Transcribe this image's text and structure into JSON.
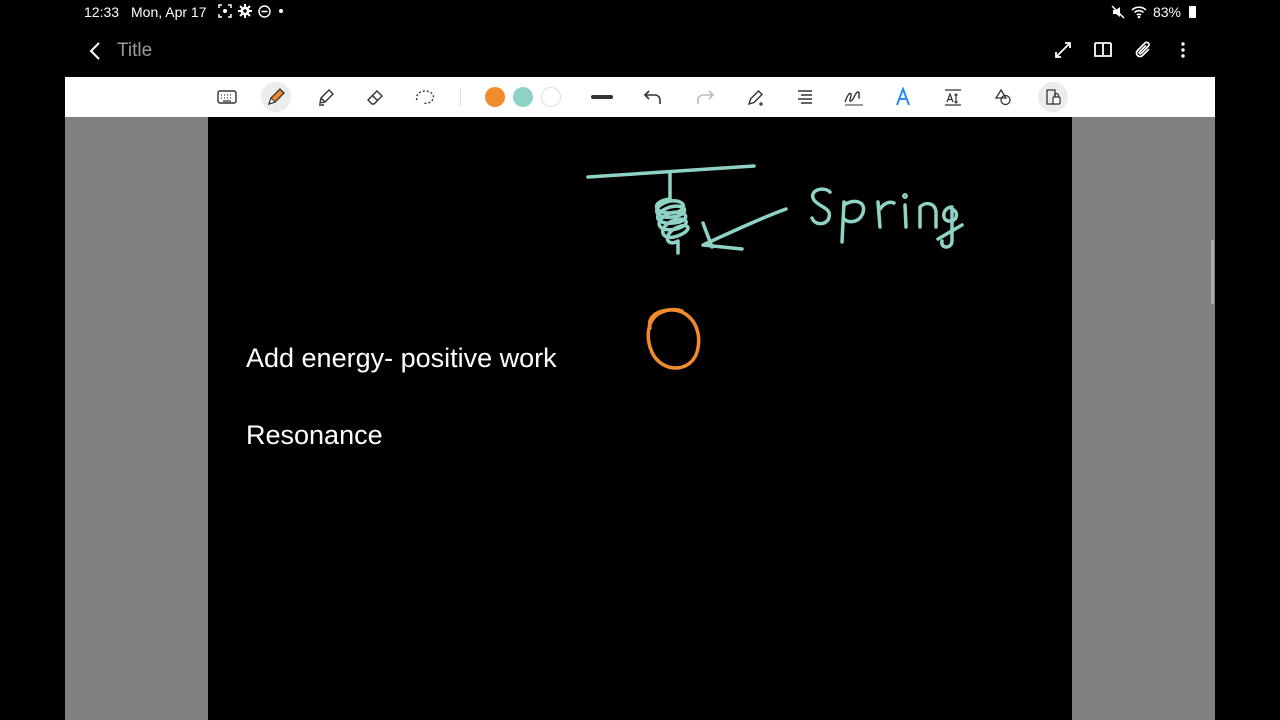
{
  "status_bar": {
    "time": "12:33",
    "date": "Mon, Apr 17",
    "battery": "83%"
  },
  "header": {
    "title": "Title"
  },
  "toolbar": {
    "colors": [
      "#f28a2e",
      "#8fd3c7",
      "#ffffff"
    ]
  },
  "note": {
    "lines": [
      "Add energy- positive work",
      "Resonance"
    ],
    "handwriting_label": "spring",
    "ink_colors": {
      "spring": "#8fd3c7",
      "mass": "#f28a2e"
    }
  }
}
